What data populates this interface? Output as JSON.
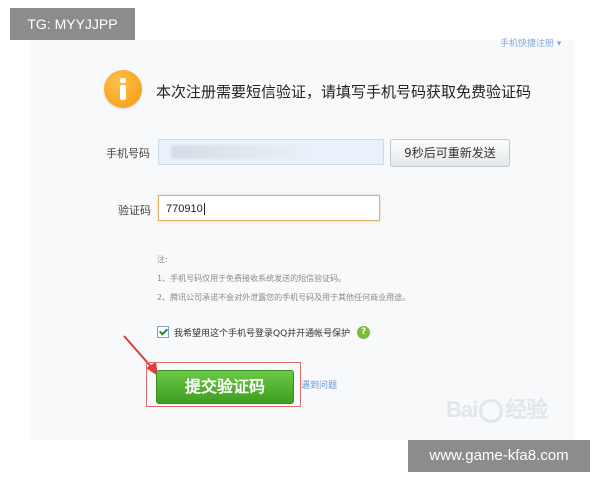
{
  "watermarks": {
    "top_left": "TG: MYYJJPP",
    "bottom_right": "www.game-kfa8.com"
  },
  "header": {
    "top_link": "手机快捷注册 ▾",
    "headline": "本次注册需要短信验证，请填写手机号码获取免费验证码"
  },
  "form": {
    "phone_label": "手机号码",
    "resend_label": "9秒后可重新发送",
    "code_label": "验证码",
    "code_value": "770910"
  },
  "notes": {
    "title": "注:",
    "line1": "1、手机号码仅用于免费接收系统发送的短信验证码。",
    "line2": "2、腾讯公司承诺不会对外泄露您的手机号码及用于其他任何商业用途。"
  },
  "options": {
    "checkbox_label": "我希望用这个手机号登录QQ并开通帐号保护",
    "help_icon": "?"
  },
  "actions": {
    "submit_label": "提交验证码",
    "side_link": "遇到问题"
  },
  "branding": {
    "baidu_left": "Bai",
    "baidu_right": "经验"
  },
  "colors": {
    "submit_green": "#4cae2c",
    "info_orange": "#f5a623",
    "annotation_red": "#e23b3b"
  }
}
